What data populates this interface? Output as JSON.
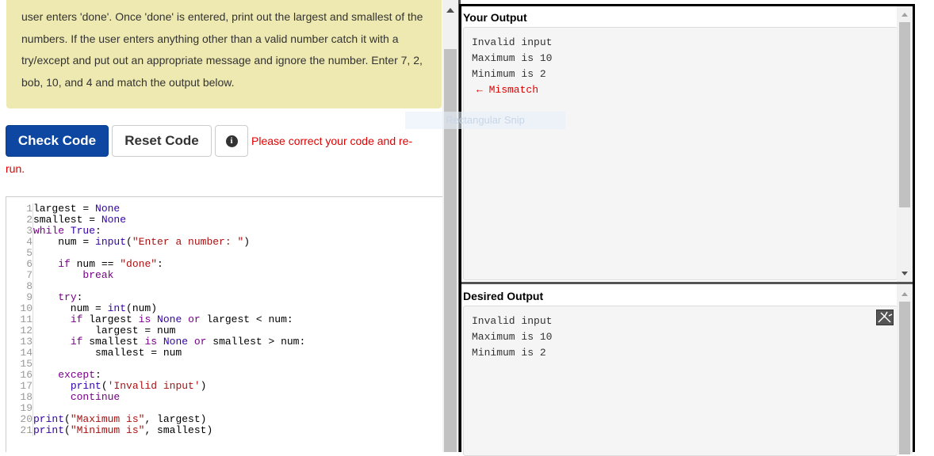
{
  "instructions": {
    "lines": [
      "user enters 'done'. Once 'done' is entered, print out the largest and smallest of the",
      "numbers. If the user enters anything other than a valid number catch it with a",
      "try/except and put out an appropriate message and ignore the number. Enter 7, 2,",
      "bob, 10, and 4 and match the output below."
    ]
  },
  "buttons": {
    "check": "Check Code",
    "reset": "Reset Code",
    "info_icon": "info-icon"
  },
  "error": {
    "part1": "Please correct your code and re-",
    "part2": "run."
  },
  "editor": {
    "line_numbers": [
      "1",
      "2",
      "3",
      "4",
      "5",
      "6",
      "7",
      "8",
      "9",
      "10",
      "11",
      "12",
      "13",
      "14",
      "15",
      "16",
      "17",
      "18",
      "19",
      "20",
      "21"
    ]
  },
  "your_output": {
    "title": "Your Output",
    "lines": [
      "Invalid input",
      "Maximum is 10",
      "Minimum is 2"
    ],
    "mismatch": "← Mismatch"
  },
  "desired_output": {
    "title": "Desired Output",
    "lines": [
      "Invalid input",
      "Maximum is 10",
      "Minimum is 2"
    ]
  },
  "overlay": {
    "snip_label": "Rectangular Snip"
  },
  "colors": {
    "instructions_bg": "#eee9b0",
    "check_button": "#0d47a1",
    "error": "#e00000"
  }
}
